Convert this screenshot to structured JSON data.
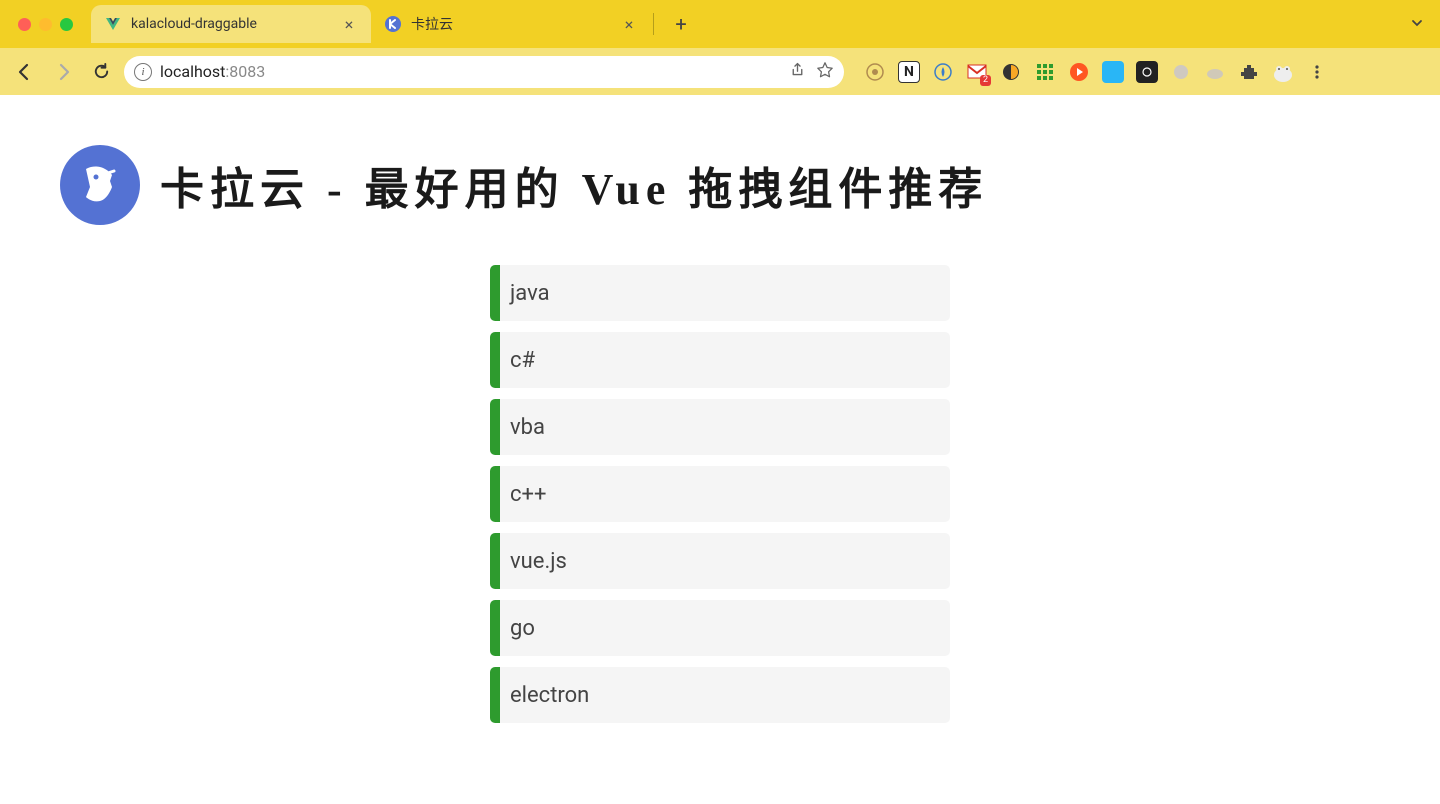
{
  "browser": {
    "tabs": [
      {
        "title": "kalacloud-draggable",
        "active": true
      },
      {
        "title": "卡拉云",
        "active": false
      }
    ],
    "address": {
      "host": "localhost",
      "port": ":8083"
    }
  },
  "page": {
    "title": "卡拉云 - 最好用的 Vue 拖拽组件推荐",
    "items": [
      "java",
      "c#",
      "vba",
      "c++",
      "vue.js",
      "go",
      "electron"
    ]
  },
  "extensions": {
    "gmail_badge": "2"
  }
}
